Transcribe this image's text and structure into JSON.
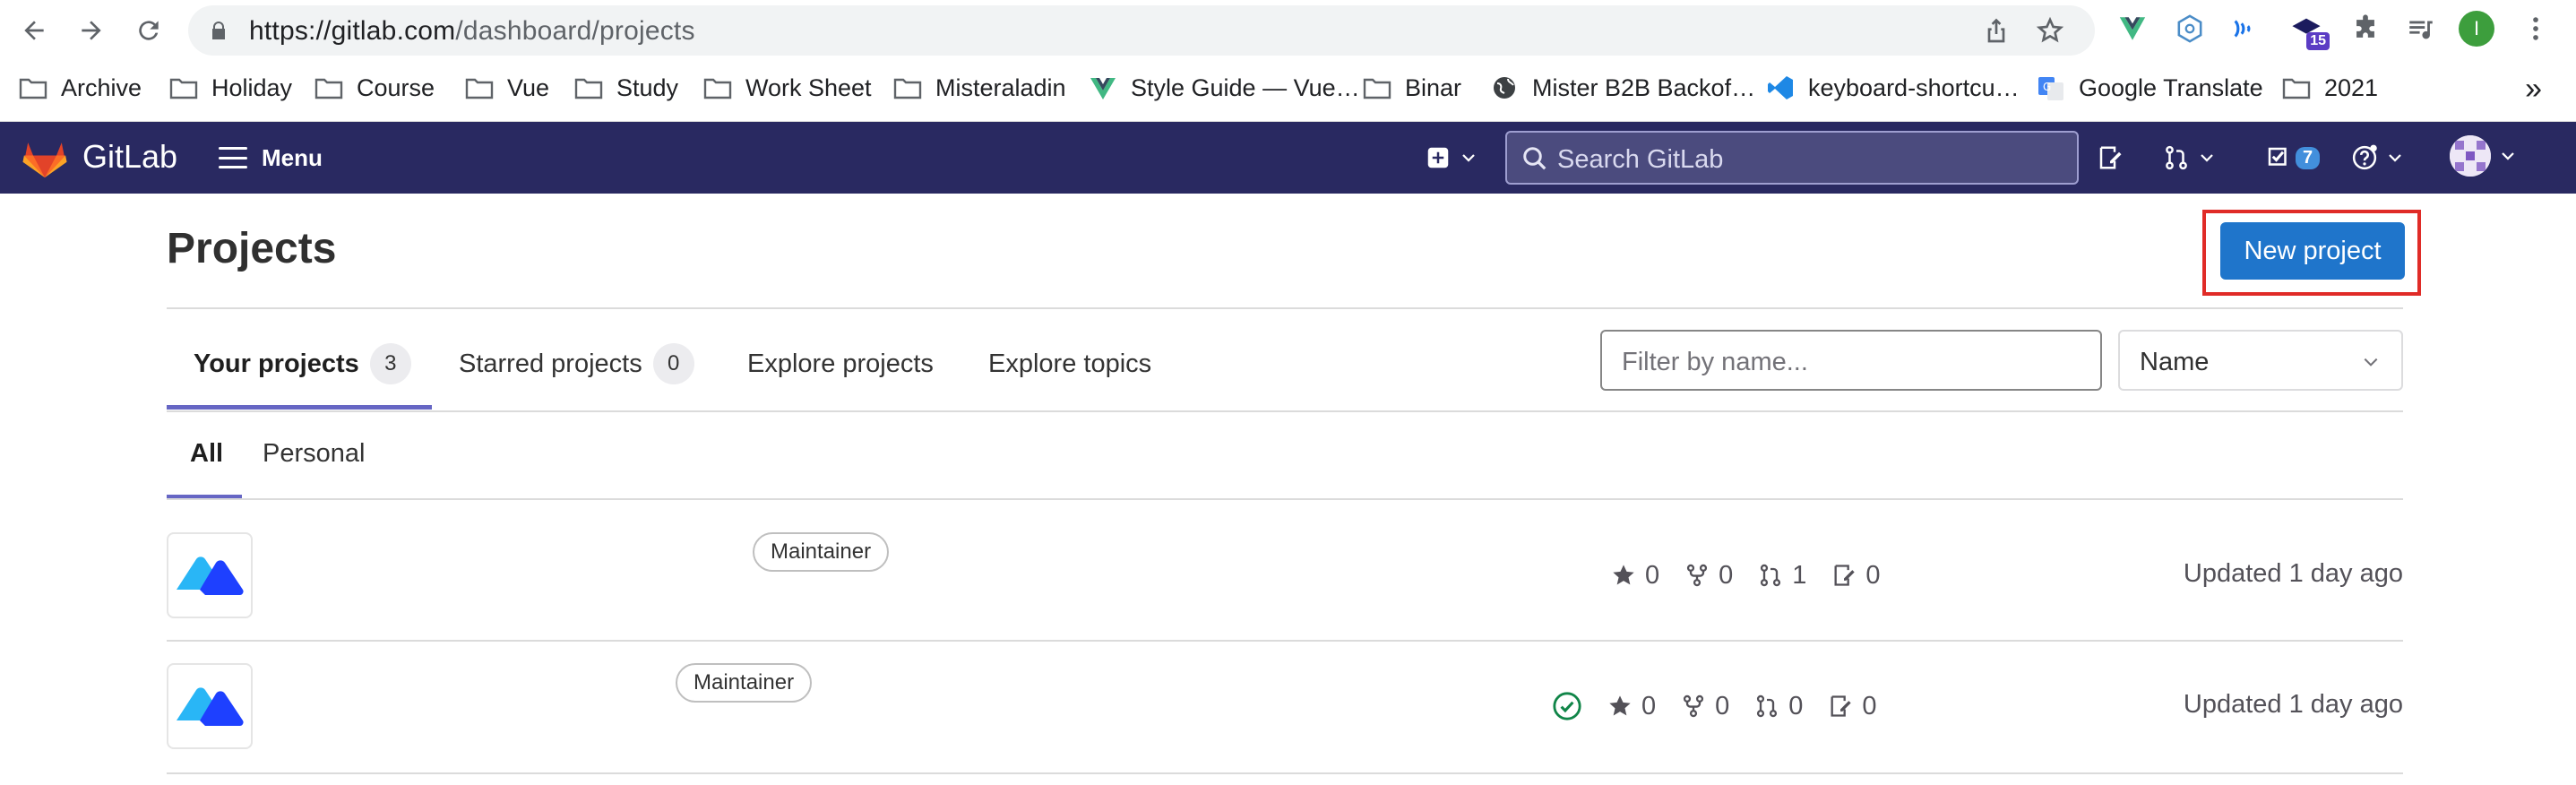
{
  "browser": {
    "url_host": "https://gitlab.com",
    "url_path": "/dashboard/projects",
    "bookmarks": [
      {
        "label": "Archive",
        "icon": "folder-icon"
      },
      {
        "label": "Holiday",
        "icon": "folder-icon"
      },
      {
        "label": "Course",
        "icon": "folder-icon"
      },
      {
        "label": "Vue",
        "icon": "folder-icon"
      },
      {
        "label": "Study",
        "icon": "folder-icon"
      },
      {
        "label": "Work Sheet",
        "icon": "folder-icon"
      },
      {
        "label": "Misteraladin",
        "icon": "folder-icon"
      },
      {
        "label": "Style Guide — Vue…",
        "icon": "vue-logo-icon"
      },
      {
        "label": "Binar",
        "icon": "folder-icon"
      },
      {
        "label": "Mister B2B Backof…",
        "icon": "globe-icon"
      },
      {
        "label": "keyboard-shortcu…",
        "icon": "vscode-icon"
      },
      {
        "label": "Google Translate",
        "icon": "google-translate-icon"
      },
      {
        "label": "2021",
        "icon": "folder-icon"
      }
    ],
    "bookmarks_more": "»",
    "extension_badge": "15",
    "profile_initial": "I"
  },
  "header": {
    "brand": "GitLab",
    "menu_label": "Menu",
    "search_placeholder": "Search GitLab",
    "todo_count": "7"
  },
  "page": {
    "title": "Projects",
    "new_project_label": "New project",
    "tabs": [
      {
        "label": "Your projects",
        "count": "3"
      },
      {
        "label": "Starred projects",
        "count": "0"
      },
      {
        "label": "Explore projects"
      },
      {
        "label": "Explore topics"
      }
    ],
    "filter_placeholder": "Filter by name...",
    "sort_value": "Name",
    "subtabs": [
      "All",
      "Personal"
    ]
  },
  "projects": [
    {
      "role": "Maintainer",
      "stars": "0",
      "forks": "0",
      "merge_requests": "1",
      "issues": "0",
      "updated": "Updated 1 day ago",
      "pipeline": ""
    },
    {
      "role": "Maintainer",
      "stars": "0",
      "forks": "0",
      "merge_requests": "0",
      "issues": "0",
      "updated": "Updated 1 day ago",
      "pipeline": "passed"
    }
  ],
  "colors": {
    "header_bg": "#292961",
    "primary": "#1f75cb",
    "tab_active": "#6666c4",
    "highlight": "#e02b27"
  }
}
